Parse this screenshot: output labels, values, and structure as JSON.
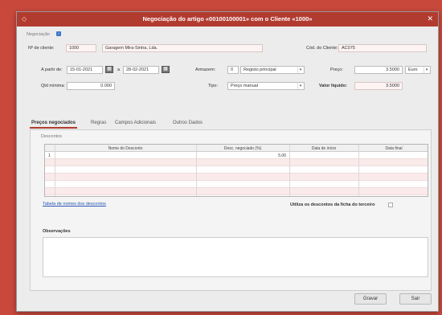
{
  "window": {
    "title": "Negociação do artigo «00100100001» com o Cliente «1000»"
  },
  "negociacao": {
    "legend": "Negociação",
    "nr_cliente_label": "Nº de cliente:",
    "nr_cliente_value": "1000",
    "cliente_nome": "Garagem Mira-Sintra, Lda.",
    "cod_cliente_label": "Cód. do Cliente:",
    "cod_cliente_value": "AC075",
    "a_partir_label": "A partir de:",
    "data_inicio": "15-01-2021",
    "a_label": "a",
    "data_fim": "28-02-2021",
    "armazem_label": "Armazem:",
    "armazem_code": "0",
    "armazem_name": "Registo principal",
    "preco_label": "Preço:",
    "preco_value": "3.5000",
    "moeda": "Euro",
    "qtd_minima_label": "Qtd mínima:",
    "qtd_minima_value": "0.000",
    "tipo_label": "Tipo:",
    "tipo_value": "Preço manual",
    "valor_liquido_label": "Valor líquido:",
    "valor_liquido_value": "3.5000"
  },
  "tabs": [
    {
      "label": "Preços negociados"
    },
    {
      "label": "Regras"
    },
    {
      "label": "Campos Adicionais"
    },
    {
      "label": "Outros Dados"
    }
  ],
  "descontos": {
    "legend": "Descontos",
    "columns": [
      "Nome do Desconto",
      "Desc. negociado (%)",
      "Data de início",
      "Data final"
    ],
    "rows": [
      {
        "num": "1",
        "nome": "",
        "desc": "5.00",
        "inicio": "",
        "fim": ""
      }
    ],
    "tabela_link": "Tabela de nomes dos descontos",
    "utiliza_label": "Utiliza os descontos da ficha do terceiro"
  },
  "observacoes": {
    "label": "Observações",
    "value": ""
  },
  "buttons": {
    "gravar": "Gravar",
    "sair": "Sair"
  }
}
